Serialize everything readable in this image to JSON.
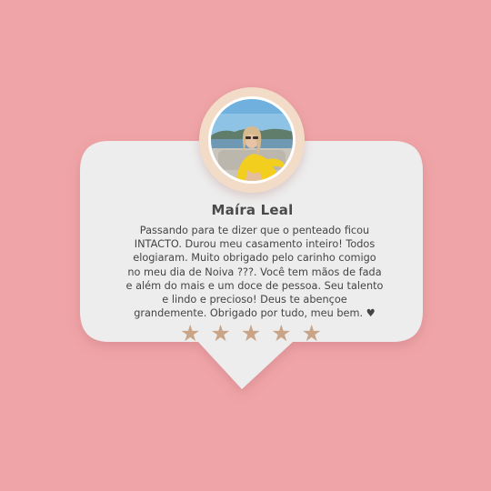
{
  "testimonial": {
    "name": "Maíra Leal",
    "review_lines": [
      "Passando para te dizer que o penteado ficou",
      "INTACTO. Durou meu casamento inteiro! Todos",
      "elogiaram. Muito obrigado pelo carinho comigo",
      "no meu dia de Noiva ???. Você tem mãos de fada",
      "e além do mais e um doce de pessoa. Seu talento",
      "e lindo e precioso! Deus te abençoe",
      "grandemente. Obrigado por tudo, meu bem. ♥"
    ],
    "rating": {
      "value": 5,
      "max": 5,
      "star_glyph": "★"
    },
    "avatar_icon": "profile-photo"
  },
  "colors": {
    "background": "#efa4a7",
    "card": "#ededed",
    "avatar_ring": "#f3dcc7",
    "star": "#c9a487",
    "name_text": "#4a4a4a",
    "body_text": "#444444"
  }
}
